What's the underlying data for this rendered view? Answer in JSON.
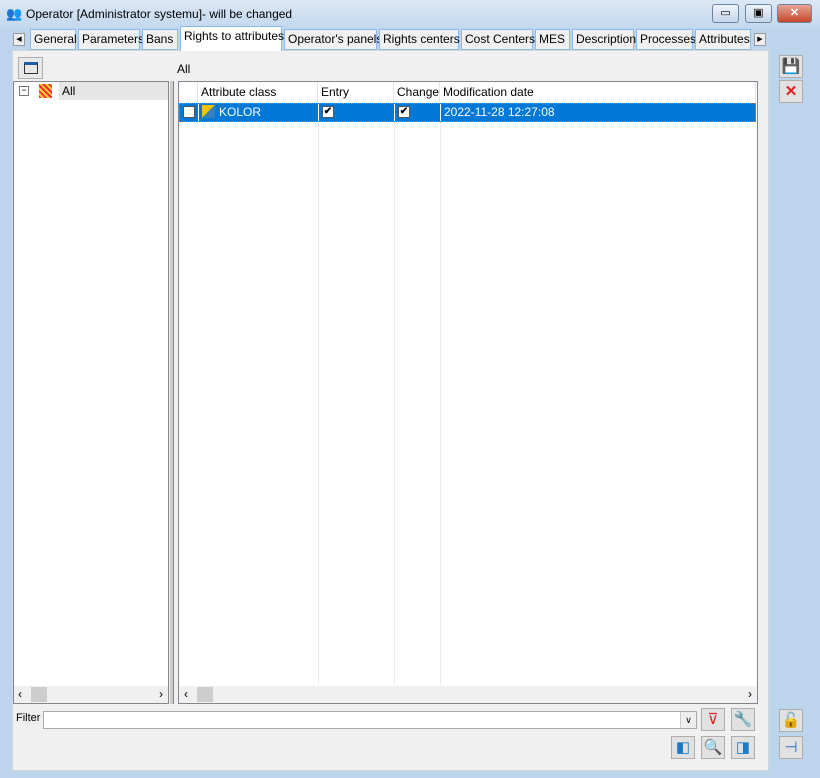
{
  "window": {
    "title": "Operator [Administrator systemu]- will be changed",
    "controls": [
      "minimize",
      "maximize",
      "close"
    ]
  },
  "tabs": [
    {
      "label": "General"
    },
    {
      "label": "Parameters"
    },
    {
      "label": "Bans"
    },
    {
      "label": "Rights to attributes",
      "active": true
    },
    {
      "label": "Operator's panels"
    },
    {
      "label": "Rights centers"
    },
    {
      "label": "Cost Centers"
    },
    {
      "label": "MES"
    },
    {
      "label": "Description"
    },
    {
      "label": "Processes"
    },
    {
      "label": "Attributes"
    }
  ],
  "tree": {
    "items": [
      {
        "label": "All",
        "expanded": true
      }
    ]
  },
  "grid": {
    "caption": "All",
    "columns": [
      "Attribute class",
      "Entry",
      "Change",
      "Modification date"
    ],
    "rows": [
      {
        "selected": false,
        "attribute_class": "KOLOR",
        "entry": true,
        "change": true,
        "modification_date": "2022-11-28 12:27:08"
      }
    ]
  },
  "filter": {
    "label": "Filter",
    "value": ""
  },
  "colors": {
    "selection": "#0078d7",
    "tab_border": "#8bbbe8"
  }
}
